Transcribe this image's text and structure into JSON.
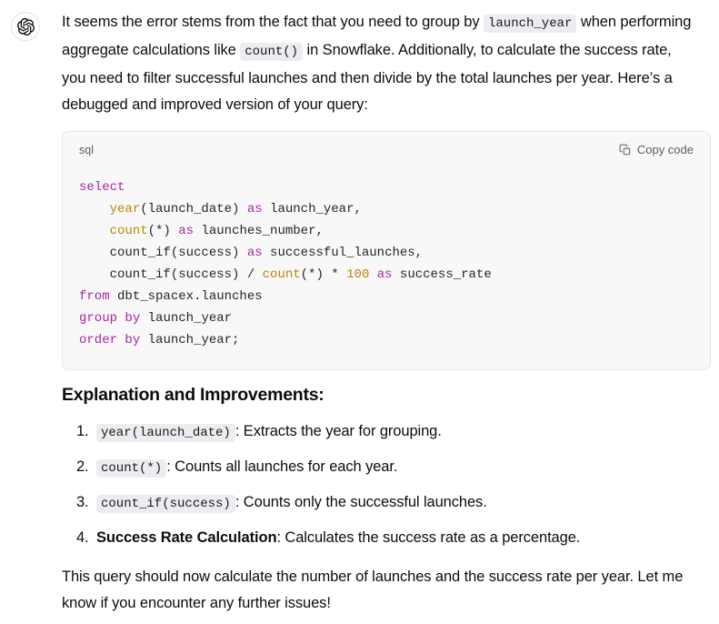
{
  "avatar": {
    "icon": "openai-logo-icon"
  },
  "intro_paragraph": {
    "part1": "It seems the error stems from the fact that you need to group by ",
    "code1": "launch_year",
    "part2": " when performing aggregate calculations like ",
    "code2": "count()",
    "part3": " in Snowflake. Additionally, to calculate the success rate, you need to filter successful launches and then divide by the total launches per year. Here’s a debugged and improved version of your query:"
  },
  "code_block": {
    "language_label": "sql",
    "copy_label": "Copy code",
    "copy_icon": "copy-icon",
    "lines": [
      {
        "tokens": [
          {
            "t": "select",
            "c": "kw"
          }
        ]
      },
      {
        "tokens": [
          {
            "t": "    ",
            "c": "def"
          },
          {
            "t": "year",
            "c": "fn"
          },
          {
            "t": "(launch_date) ",
            "c": "def"
          },
          {
            "t": "as",
            "c": "kw"
          },
          {
            "t": " launch_year,",
            "c": "def"
          }
        ]
      },
      {
        "tokens": [
          {
            "t": "    ",
            "c": "def"
          },
          {
            "t": "count",
            "c": "fn"
          },
          {
            "t": "(*) ",
            "c": "def"
          },
          {
            "t": "as",
            "c": "kw"
          },
          {
            "t": " launches_number,",
            "c": "def"
          }
        ]
      },
      {
        "tokens": [
          {
            "t": "    count_if(success) ",
            "c": "def"
          },
          {
            "t": "as",
            "c": "kw"
          },
          {
            "t": " successful_launches,",
            "c": "def"
          }
        ]
      },
      {
        "tokens": [
          {
            "t": "    count_if(success) / ",
            "c": "def"
          },
          {
            "t": "count",
            "c": "fn"
          },
          {
            "t": "(*) * ",
            "c": "def"
          },
          {
            "t": "100",
            "c": "num"
          },
          {
            "t": " ",
            "c": "def"
          },
          {
            "t": "as",
            "c": "kw"
          },
          {
            "t": " success_rate",
            "c": "def"
          }
        ]
      },
      {
        "tokens": [
          {
            "t": "from",
            "c": "kw"
          },
          {
            "t": " dbt_spacex.launches",
            "c": "def"
          }
        ]
      },
      {
        "tokens": [
          {
            "t": "group",
            "c": "kw"
          },
          {
            "t": " ",
            "c": "def"
          },
          {
            "t": "by",
            "c": "kw"
          },
          {
            "t": " launch_year",
            "c": "def"
          }
        ]
      },
      {
        "tokens": [
          {
            "t": "order",
            "c": "kw"
          },
          {
            "t": " ",
            "c": "def"
          },
          {
            "t": "by",
            "c": "kw"
          },
          {
            "t": " launch_year;",
            "c": "def"
          }
        ]
      }
    ]
  },
  "section_heading": "Explanation and Improvements:",
  "steps": [
    {
      "code": "year(launch_date)",
      "bold": "",
      "text": ": Extracts the year for grouping."
    },
    {
      "code": "count(*)",
      "bold": "",
      "text": ": Counts all launches for each year."
    },
    {
      "code": "count_if(success)",
      "bold": "",
      "text": ": Counts only the successful launches."
    },
    {
      "code": "",
      "bold": "Success Rate Calculation",
      "text": ": Calculates the success rate as a percentage."
    }
  ],
  "closing_paragraph": "This query should now calculate the number of launches and the success rate per year. Let me know if you encounter any further issues!",
  "colors": {
    "keyword": "#a626a4",
    "function": "#b8860b",
    "number": "#b8860b",
    "code_bg": "#f8f8f8",
    "inline_code_bg": "#ececf1",
    "text": "#0d0d0d"
  }
}
